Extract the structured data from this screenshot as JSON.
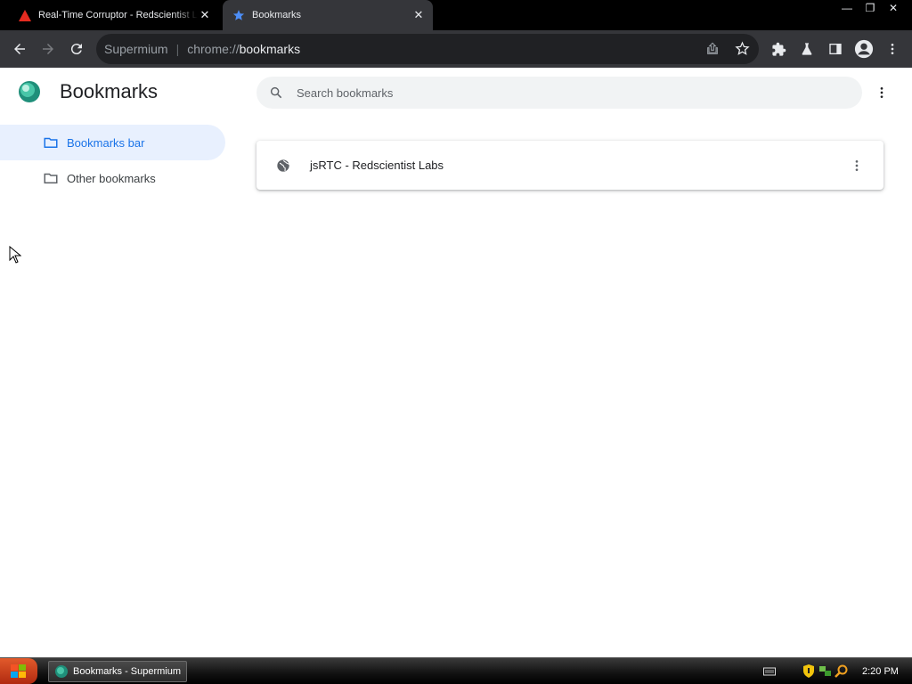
{
  "tabs": [
    {
      "title": "Real-Time Corruptor - Redscientist Labs",
      "icon": "warning-triangle-icon",
      "close": "✕"
    },
    {
      "title": "Bookmarks",
      "icon": "star-icon",
      "close": "✕"
    }
  ],
  "window_controls": {
    "minimize": "—",
    "restore": "❐",
    "close": "✕"
  },
  "omnibox": {
    "scheme_label": "Supermium",
    "separator": "|",
    "url_prefix": "chrome://",
    "url_host": "bookmarks"
  },
  "bookmarks_page": {
    "title": "Bookmarks",
    "search_placeholder": "Search bookmarks",
    "sidebar": [
      {
        "label": "Bookmarks bar",
        "selected": true
      },
      {
        "label": "Other bookmarks",
        "selected": false
      }
    ],
    "items": [
      {
        "label": "jsRTC - Redscientist Labs",
        "icon": "globe-icon"
      }
    ]
  },
  "taskbar": {
    "task_label": "Bookmarks - Supermium",
    "clock": "2:20 PM"
  },
  "colors": {
    "accent": "#1a73e8",
    "selected_bg": "#e8f0fe",
    "toolbar": "#35363a",
    "tabstrip": "#000000"
  }
}
